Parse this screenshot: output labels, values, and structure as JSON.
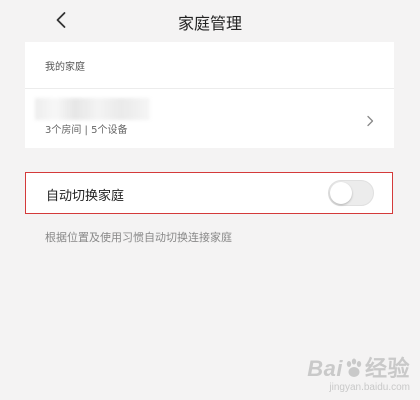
{
  "header": {
    "title": "家庭管理",
    "back_icon": "chevron-left-icon"
  },
  "my_family": {
    "section_label": "我的家庭",
    "family": {
      "summary": "3个房间 | 5个设备",
      "arrow_icon": "chevron-right-icon"
    }
  },
  "auto_switch": {
    "label": "自动切换家庭",
    "enabled": false,
    "hint": "根据位置及使用习惯自动切换连接家庭",
    "highlight_color": "#d43a3a"
  },
  "watermark": {
    "logo": "Bai 经验",
    "url": "jingyan.baidu.com"
  },
  "colors": {
    "background": "#f4f3f3",
    "card": "#ffffff",
    "toggle_off": "#ececec"
  }
}
